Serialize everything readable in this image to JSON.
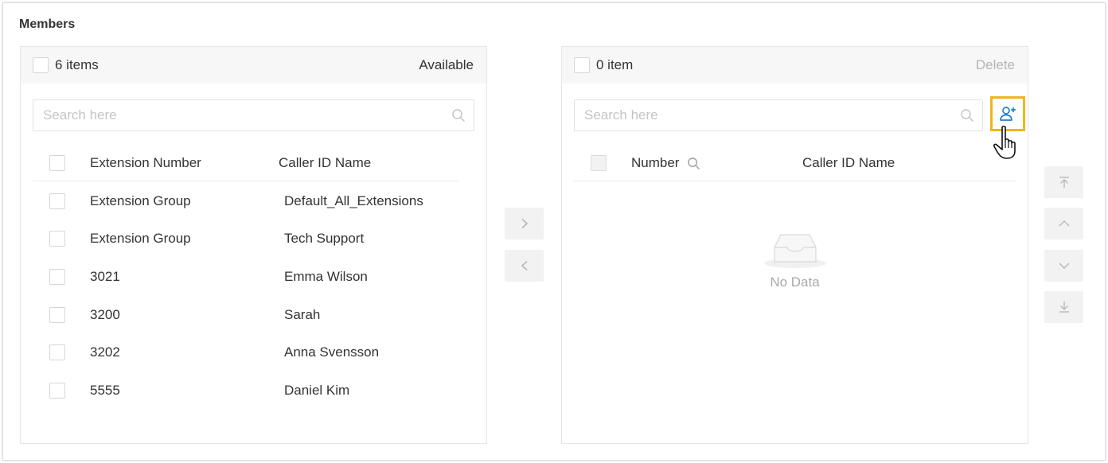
{
  "section_title": "Members",
  "available_panel": {
    "count_label": "6 items",
    "title": "Available",
    "search_placeholder": "Search here",
    "columns": [
      "Extension Number",
      "Caller ID Name"
    ],
    "rows": [
      {
        "number": "Extension Group",
        "caller_id": "Default_All_Extensions"
      },
      {
        "number": "Extension Group",
        "caller_id": "Tech Support"
      },
      {
        "number": "3021",
        "caller_id": "Emma Wilson"
      },
      {
        "number": "3200",
        "caller_id": "Sarah"
      },
      {
        "number": "3202",
        "caller_id": "Anna Svensson"
      },
      {
        "number": "5555",
        "caller_id": "Daniel Kim"
      }
    ]
  },
  "selected_panel": {
    "count_label": "0 item",
    "action": "Delete",
    "search_placeholder": "Search here",
    "columns": [
      "Number",
      "Caller ID Name"
    ],
    "empty_text": "No Data"
  },
  "icons": {
    "add_member": "user-plus-icon",
    "transfer_right": "chevron-right-icon",
    "transfer_left": "chevron-left-icon",
    "move_top": "arrow-to-top-icon",
    "move_up": "chevron-up-icon",
    "move_down": "chevron-down-icon",
    "move_bottom": "arrow-to-bottom-icon"
  },
  "colors": {
    "highlight": "#f0b51b",
    "accent": "#1f7fd1",
    "muted_text": "#b5b5b5"
  }
}
